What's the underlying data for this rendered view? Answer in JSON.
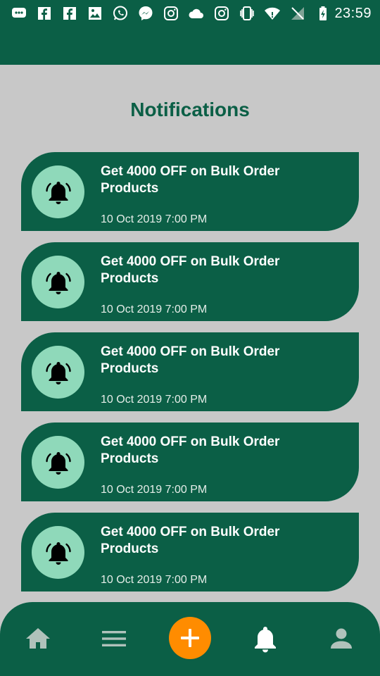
{
  "status_bar": {
    "time": "23:59",
    "icons": [
      "message-icon",
      "facebook-icon",
      "facebook-icon",
      "gallery-icon",
      "whatsapp-icon",
      "messenger-icon",
      "instagram-icon",
      "cloud-icon",
      "instagram-icon",
      "vibrate-icon",
      "wifi-icon",
      "no-signal-icon",
      "battery-charging-icon"
    ]
  },
  "page": {
    "title": "Notifications"
  },
  "notifications": [
    {
      "title": "Get 4000 OFF on Bulk Order Products",
      "time": "10 Oct 2019 7:00 PM",
      "icon": "bell-icon"
    },
    {
      "title": "Get 4000 OFF on Bulk Order Products",
      "time": "10 Oct 2019 7:00 PM",
      "icon": "bell-icon"
    },
    {
      "title": "Get 4000 OFF on Bulk Order Products",
      "time": "10 Oct 2019 7:00 PM",
      "icon": "bell-icon"
    },
    {
      "title": "Get 4000 OFF on Bulk Order Products",
      "time": "10 Oct 2019 7:00 PM",
      "icon": "bell-icon"
    },
    {
      "title": "Get 4000 OFF on Bulk Order Products",
      "time": "10 Oct 2019 7:00 PM",
      "icon": "bell-icon"
    }
  ],
  "bottom_nav": {
    "items": [
      "home-icon",
      "menu-icon",
      "add-icon",
      "bell-icon",
      "profile-icon"
    ],
    "active": "bell-icon"
  },
  "colors": {
    "primary": "#0b5f46",
    "accent": "#ff8c00",
    "icon_circle": "#8fd9ba",
    "background": "#c8c8c8"
  }
}
